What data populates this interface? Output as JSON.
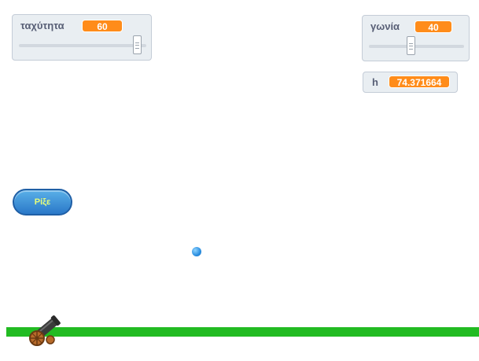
{
  "monitors": {
    "speed": {
      "label": "ταχύτητα",
      "value": "60",
      "slider_position": 0.96
    },
    "angle": {
      "label": "γωνία",
      "value": "40",
      "slider_position": 0.44
    },
    "height": {
      "label": "h",
      "value": "74.371664"
    }
  },
  "fire_button": {
    "label": "Ρίξε"
  },
  "colors": {
    "monitor_value": "#ff8c1a",
    "ground": "#22bb22",
    "ball": "#2a8ee0",
    "button": "#2a78c8"
  },
  "sprites": {
    "cannon": "cannon-icon",
    "ball": "cannonball-icon"
  }
}
